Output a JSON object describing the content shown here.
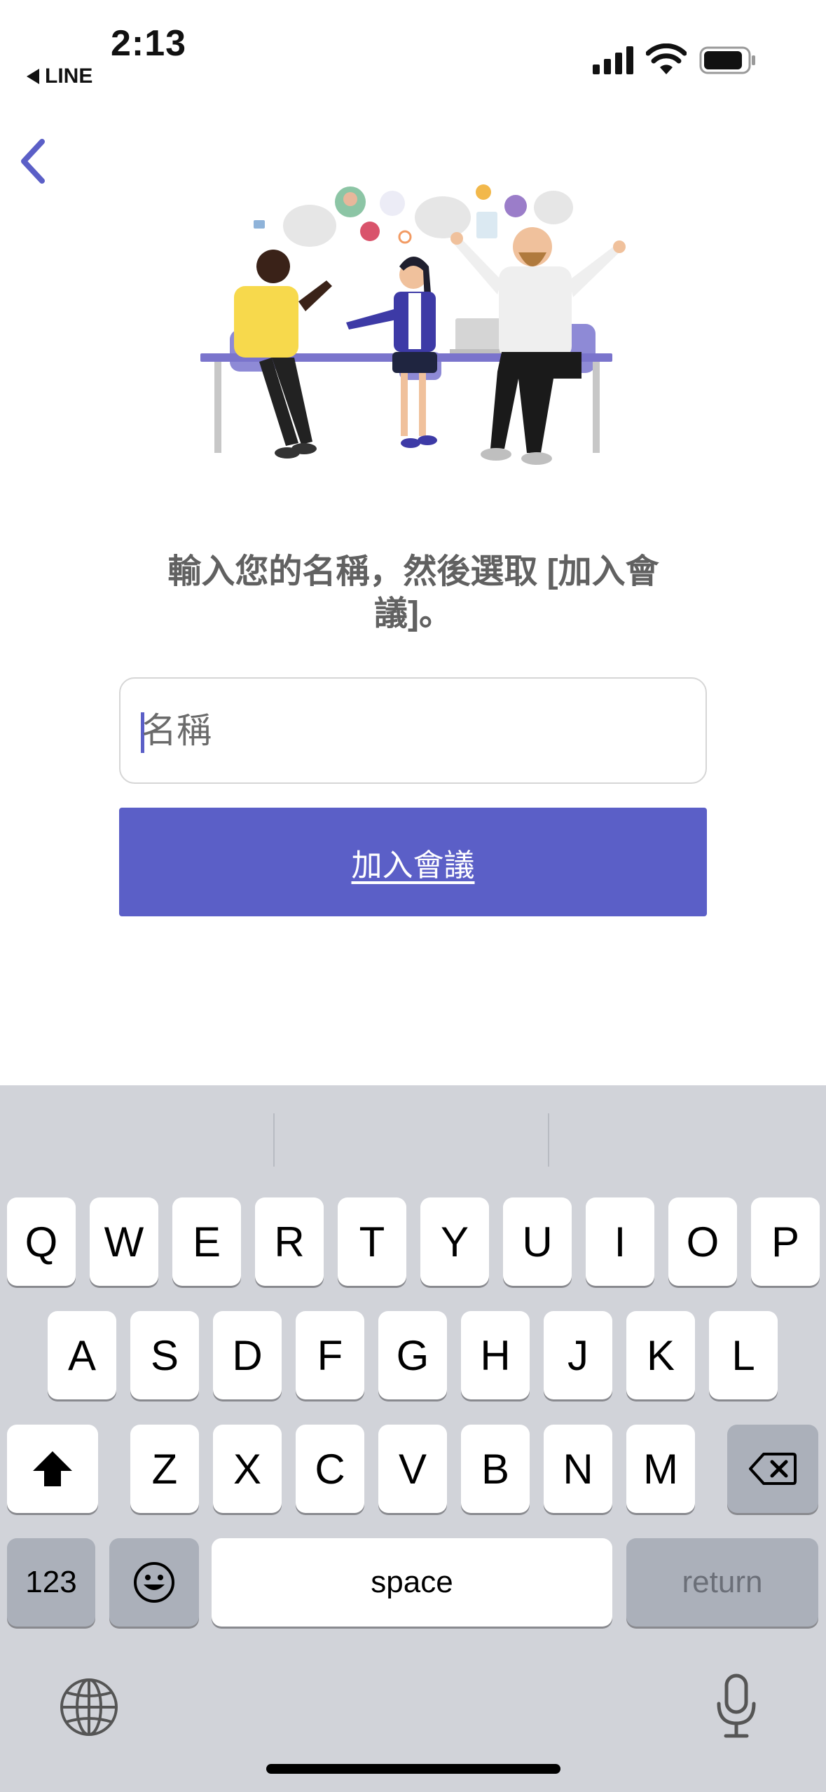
{
  "status_bar": {
    "time": "2:13",
    "back_app_label": "LINE"
  },
  "main": {
    "prompt": "輸入您的名稱，然後選取 [加入會議]。",
    "name_input": {
      "placeholder": "名稱",
      "value": ""
    },
    "join_button_label": "加入會議"
  },
  "keyboard": {
    "row1": [
      "Q",
      "W",
      "E",
      "R",
      "T",
      "Y",
      "U",
      "I",
      "O",
      "P"
    ],
    "row2": [
      "A",
      "S",
      "D",
      "F",
      "G",
      "H",
      "J",
      "K",
      "L"
    ],
    "row3": [
      "Z",
      "X",
      "C",
      "V",
      "B",
      "N",
      "M"
    ],
    "numbers_label": "123",
    "space_label": "space",
    "return_label": "return"
  },
  "colors": {
    "accent": "#5b5fc7",
    "keyboard_bg": "#d1d3d9"
  }
}
